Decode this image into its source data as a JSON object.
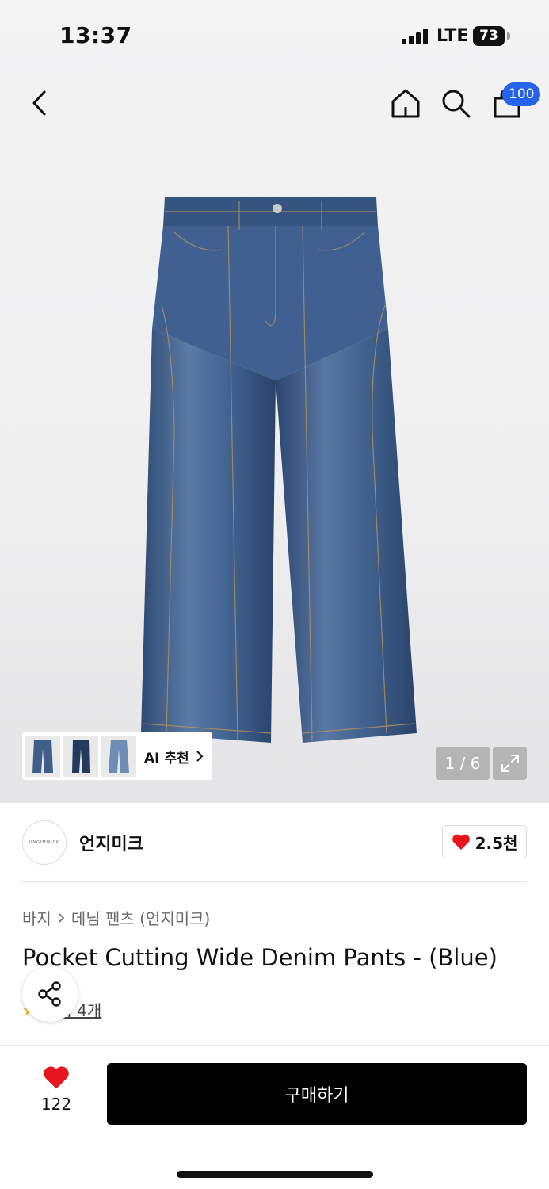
{
  "status_bar": {
    "time": "13:37",
    "network": "LTE",
    "battery": "73"
  },
  "nav": {
    "cart_count": "100",
    "icons": [
      "back-icon",
      "home-icon",
      "search-icon",
      "cart-icon"
    ]
  },
  "gallery": {
    "pager": "1 / 6",
    "ai_recommend_label": "AI 추천"
  },
  "brand": {
    "logo_text": "UNGIMMICK",
    "name": "언지미크",
    "likes": "2.5천"
  },
  "breadcrumb": {
    "category": "바지",
    "subcategory": "데님 팬츠 (언지미크)"
  },
  "product": {
    "title": "Pocket Cutting Wide Denim Pants - (Blue)",
    "review_text": "후기 4개"
  },
  "bottom_bar": {
    "wish_count": "122",
    "buy_label": "구매하기"
  },
  "colors": {
    "badge_blue": "#2563eb",
    "heart_red": "#e8141e",
    "denim": "#3b5b86"
  }
}
